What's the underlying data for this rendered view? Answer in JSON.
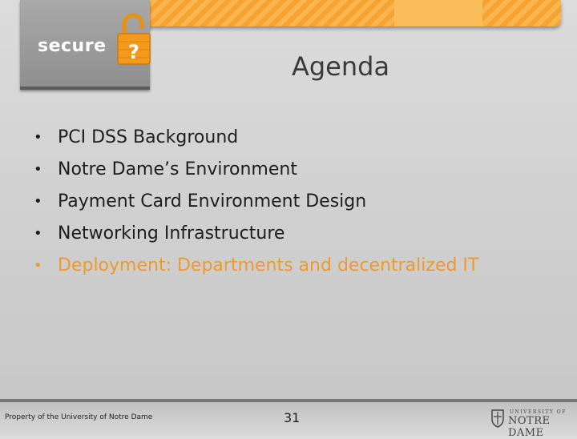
{
  "header": {
    "logo_text": "secure",
    "logo_symbol": "?"
  },
  "slide": {
    "title": "Agenda",
    "bullets": [
      {
        "text": "PCI DSS Background"
      },
      {
        "text": "Notre Dame’s Environment"
      },
      {
        "text": "Payment Card Environment Design"
      },
      {
        "text": "Networking Infrastructure"
      },
      {
        "text": "Deployment: Departments and decentralized IT"
      }
    ],
    "bullet_glyph": "•"
  },
  "footer": {
    "left_text": "Property of the University of Notre Dame",
    "page_number": "31",
    "logo_university": "UNIVERSITY OF",
    "logo_name": "NOTRE DAME"
  },
  "colors": {
    "accent_orange": "#f6a431",
    "highlight_bullet": "#f09a2a",
    "text_dark": "#1e1e1e"
  },
  "icons": [
    "padlock-question-icon",
    "notre-dame-shield-icon"
  ]
}
